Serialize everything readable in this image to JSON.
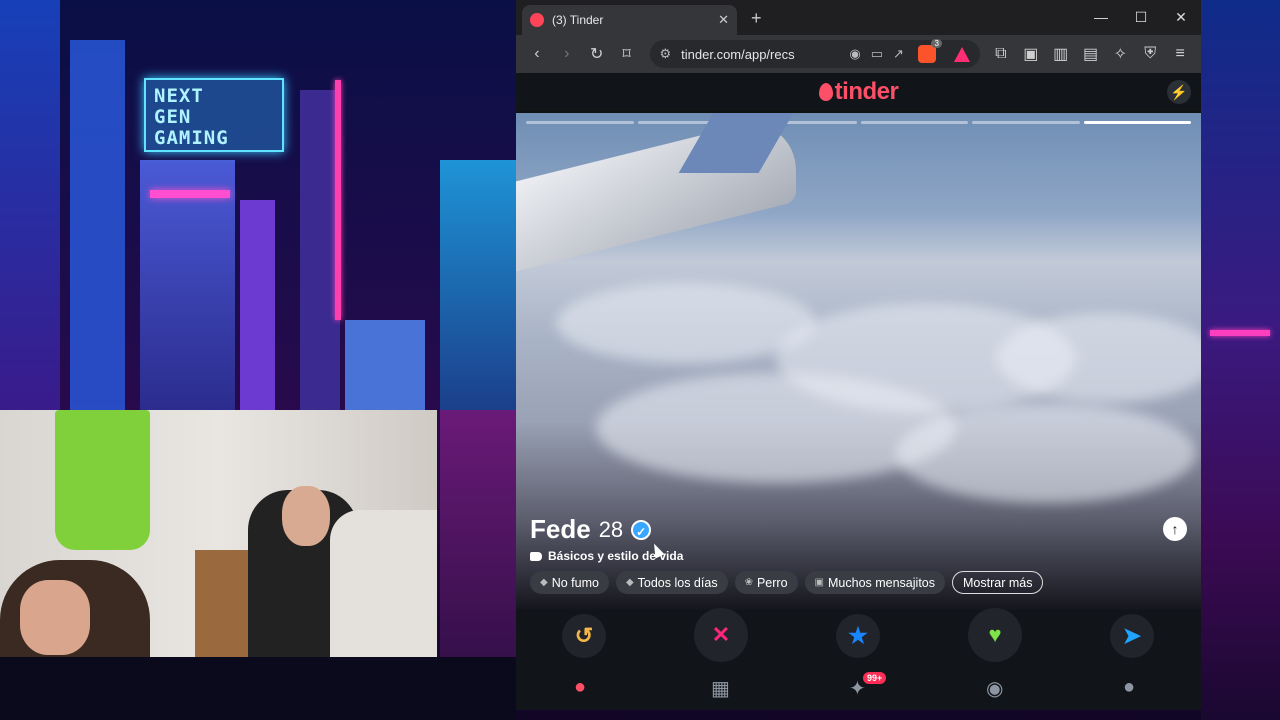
{
  "backdrop": {
    "neon_sign": [
      "NEXT",
      "GEN",
      "GAMING"
    ]
  },
  "browser": {
    "tab_title": "(3) Tinder",
    "tab_close": "✕",
    "new_tab": "+",
    "window_controls": [
      "—",
      "☐",
      "✕"
    ],
    "url": "tinder.com/app/recs",
    "brave_badge": "3",
    "toolbar_icons": [
      "back-icon",
      "forward-icon",
      "reload-icon",
      "bookmark-icon",
      "site-info-icon",
      "location-icon",
      "cast-icon",
      "share-icon",
      "brave-shields-icon",
      "brave-rewards-icon",
      "extensions-icon",
      "screenshot-icon",
      "sidebar-icon",
      "wallet-icon",
      "leo-ai-icon",
      "vpn-icon",
      "menu-icon"
    ]
  },
  "tinder": {
    "logo": "tinder",
    "photo_count": 6,
    "active_photo_index": 5,
    "profile": {
      "name": "Fede",
      "age": "28",
      "verified": true,
      "subline": "Básicos y estilo de vida"
    },
    "chips": [
      {
        "icon": "smoke-icon",
        "label": "No fumo"
      },
      {
        "icon": "drink-icon",
        "label": "Todos los días"
      },
      {
        "icon": "paw-icon",
        "label": "Perro"
      },
      {
        "icon": "chat-icon",
        "label": "Muchos mensajitos"
      }
    ],
    "more_label": "Mostrar más",
    "actions": [
      {
        "name": "rewind",
        "glyph": "↺",
        "color": "#f5b748"
      },
      {
        "name": "nope",
        "glyph": "✕",
        "color": "#fd267d"
      },
      {
        "name": "super-like",
        "glyph": "★",
        "color": "#1786ff"
      },
      {
        "name": "like",
        "glyph": "♥",
        "color": "#7ee24b"
      },
      {
        "name": "boost-send",
        "glyph": "➤",
        "color": "#21a4ff"
      }
    ],
    "nav": [
      {
        "name": "recs",
        "glyph": "●",
        "active": true
      },
      {
        "name": "explore",
        "glyph": "▦",
        "active": false
      },
      {
        "name": "likes",
        "glyph": "✦",
        "active": false,
        "badge": "99+"
      },
      {
        "name": "messages",
        "glyph": "◉",
        "active": false
      },
      {
        "name": "profile",
        "glyph": "●",
        "active": false
      }
    ]
  },
  "colors": {
    "tinder_accent": "#fd5068",
    "verified_blue": "#39a7ff"
  }
}
